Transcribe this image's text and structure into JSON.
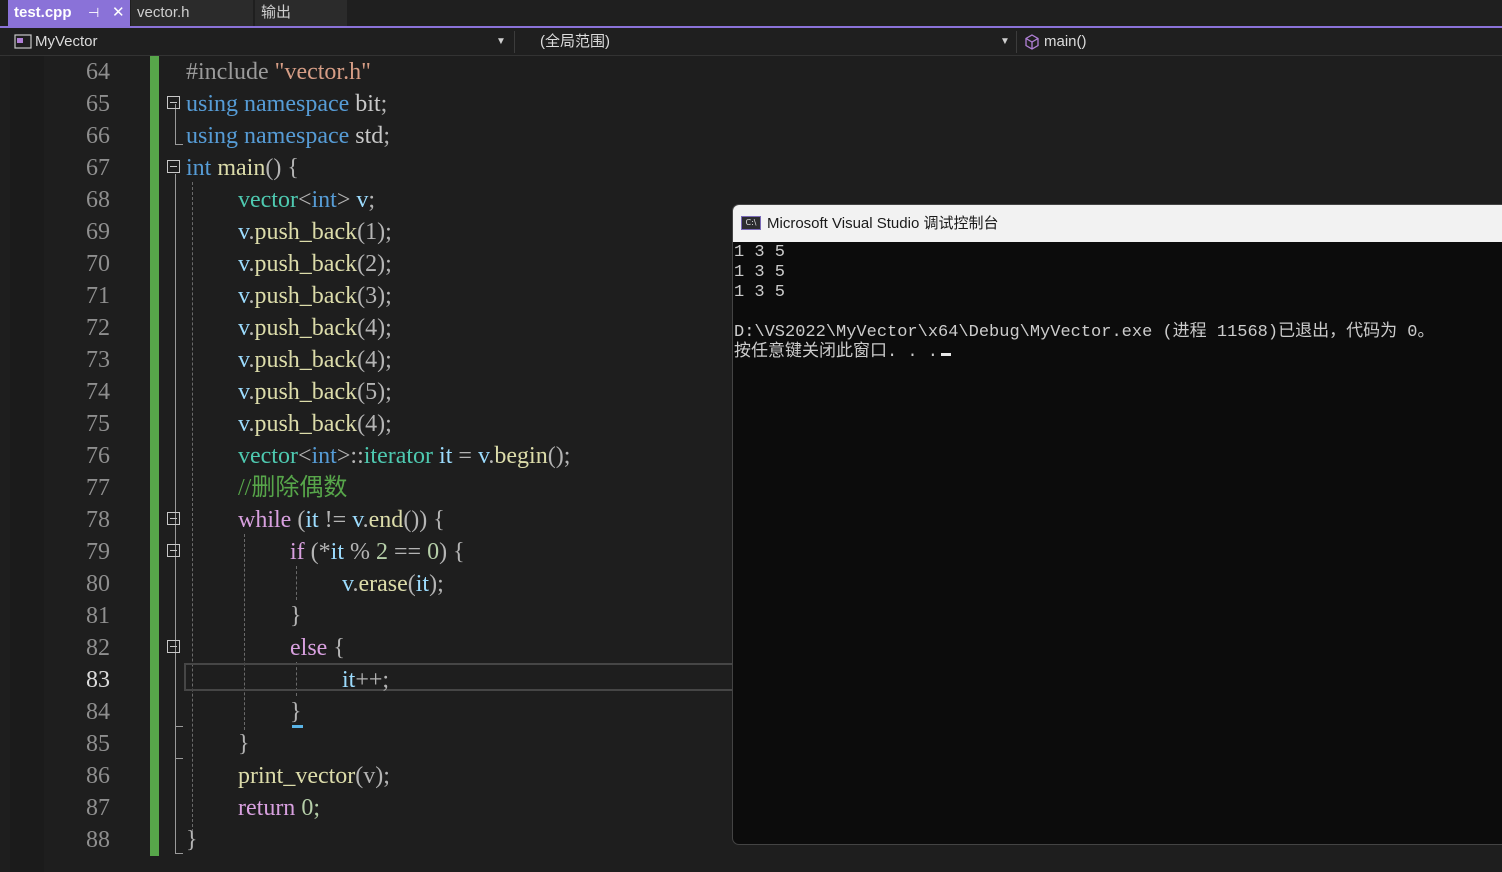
{
  "tabs": [
    {
      "label": "test.cpp",
      "active": true,
      "pin": "⊣",
      "close": "✕"
    },
    {
      "label": "vector.h",
      "active": false
    },
    {
      "label": "输出",
      "active": false
    }
  ],
  "nav": {
    "project": "MyVector",
    "scope": "(全局范围)",
    "member": "main()"
  },
  "editor": {
    "line_numbers": [
      "64",
      "65",
      "66",
      "67",
      "68",
      "69",
      "70",
      "71",
      "72",
      "73",
      "74",
      "75",
      "76",
      "77",
      "78",
      "79",
      "80",
      "81",
      "82",
      "83",
      "84",
      "85",
      "86",
      "87",
      "88"
    ],
    "active_line": "83",
    "code": {
      "l64_include": "#include ",
      "l64_file": "\"vector.h\"",
      "using_kw": "using",
      "namespace_kw": "namespace",
      "l65_ns": " bit",
      "l66_ns": " std",
      "semicolon": ";",
      "l67_int": "int",
      "l67_main": " main",
      "l67_rest": "() {",
      "vector": "vector",
      "lt": "<",
      "int": "int",
      "gt": ">",
      "l68_v": " v",
      "v": "v",
      "dot": ".",
      "push_back": "push_back",
      "pb_args": [
        "(1);",
        "(2);",
        "(3);",
        "(4);",
        "(4);",
        "(5);",
        "(4);"
      ],
      "l76_scope": "::",
      "l76_iter": "iterator",
      "l76_it": " it",
      "l76_eq": " = ",
      "l76_begin": "begin",
      "l76_end": "();",
      "l77_comment": "//删除偶数",
      "while_kw": "while",
      "l78_open": " (",
      "it": "it",
      "l78_ne": " != ",
      "l78_end": "end",
      "l78_close": "()) {",
      "if_kw": "if",
      "l79_open": " (*",
      "l79_mod": " % ",
      "num2": "2",
      "l79_eqeq": " == ",
      "num0": "0",
      "l79_close": ") {",
      "erase": "erase",
      "l80_args_open": "(",
      "l80_args_close": ");",
      "close_brace": "}",
      "else_kw": "else",
      "open_brace": " {",
      "l83_inc": "++;",
      "print_vector": "print_vector",
      "l86_args": "(v);",
      "return_kw": "return",
      "l87_rest": " 0;"
    }
  },
  "console": {
    "title": "Microsoft Visual Studio 调试控制台",
    "icon_text": "C:\\",
    "lines": [
      "1 3 5",
      "1 3 5",
      "1 3 5",
      "",
      "D:\\VS2022\\MyVector\\x64\\Debug\\MyVector.exe (进程 11568)已退出，代码为 0。",
      "按任意键关闭此窗口. . ."
    ]
  },
  "colors": {
    "accent": "#8a72d8",
    "keyword": "#569cd6",
    "control_keyword": "#d8a0df",
    "type": "#4ec9b0",
    "function": "#dcdcaa",
    "comment": "#57a64a",
    "change_bar": "#57a64a"
  }
}
